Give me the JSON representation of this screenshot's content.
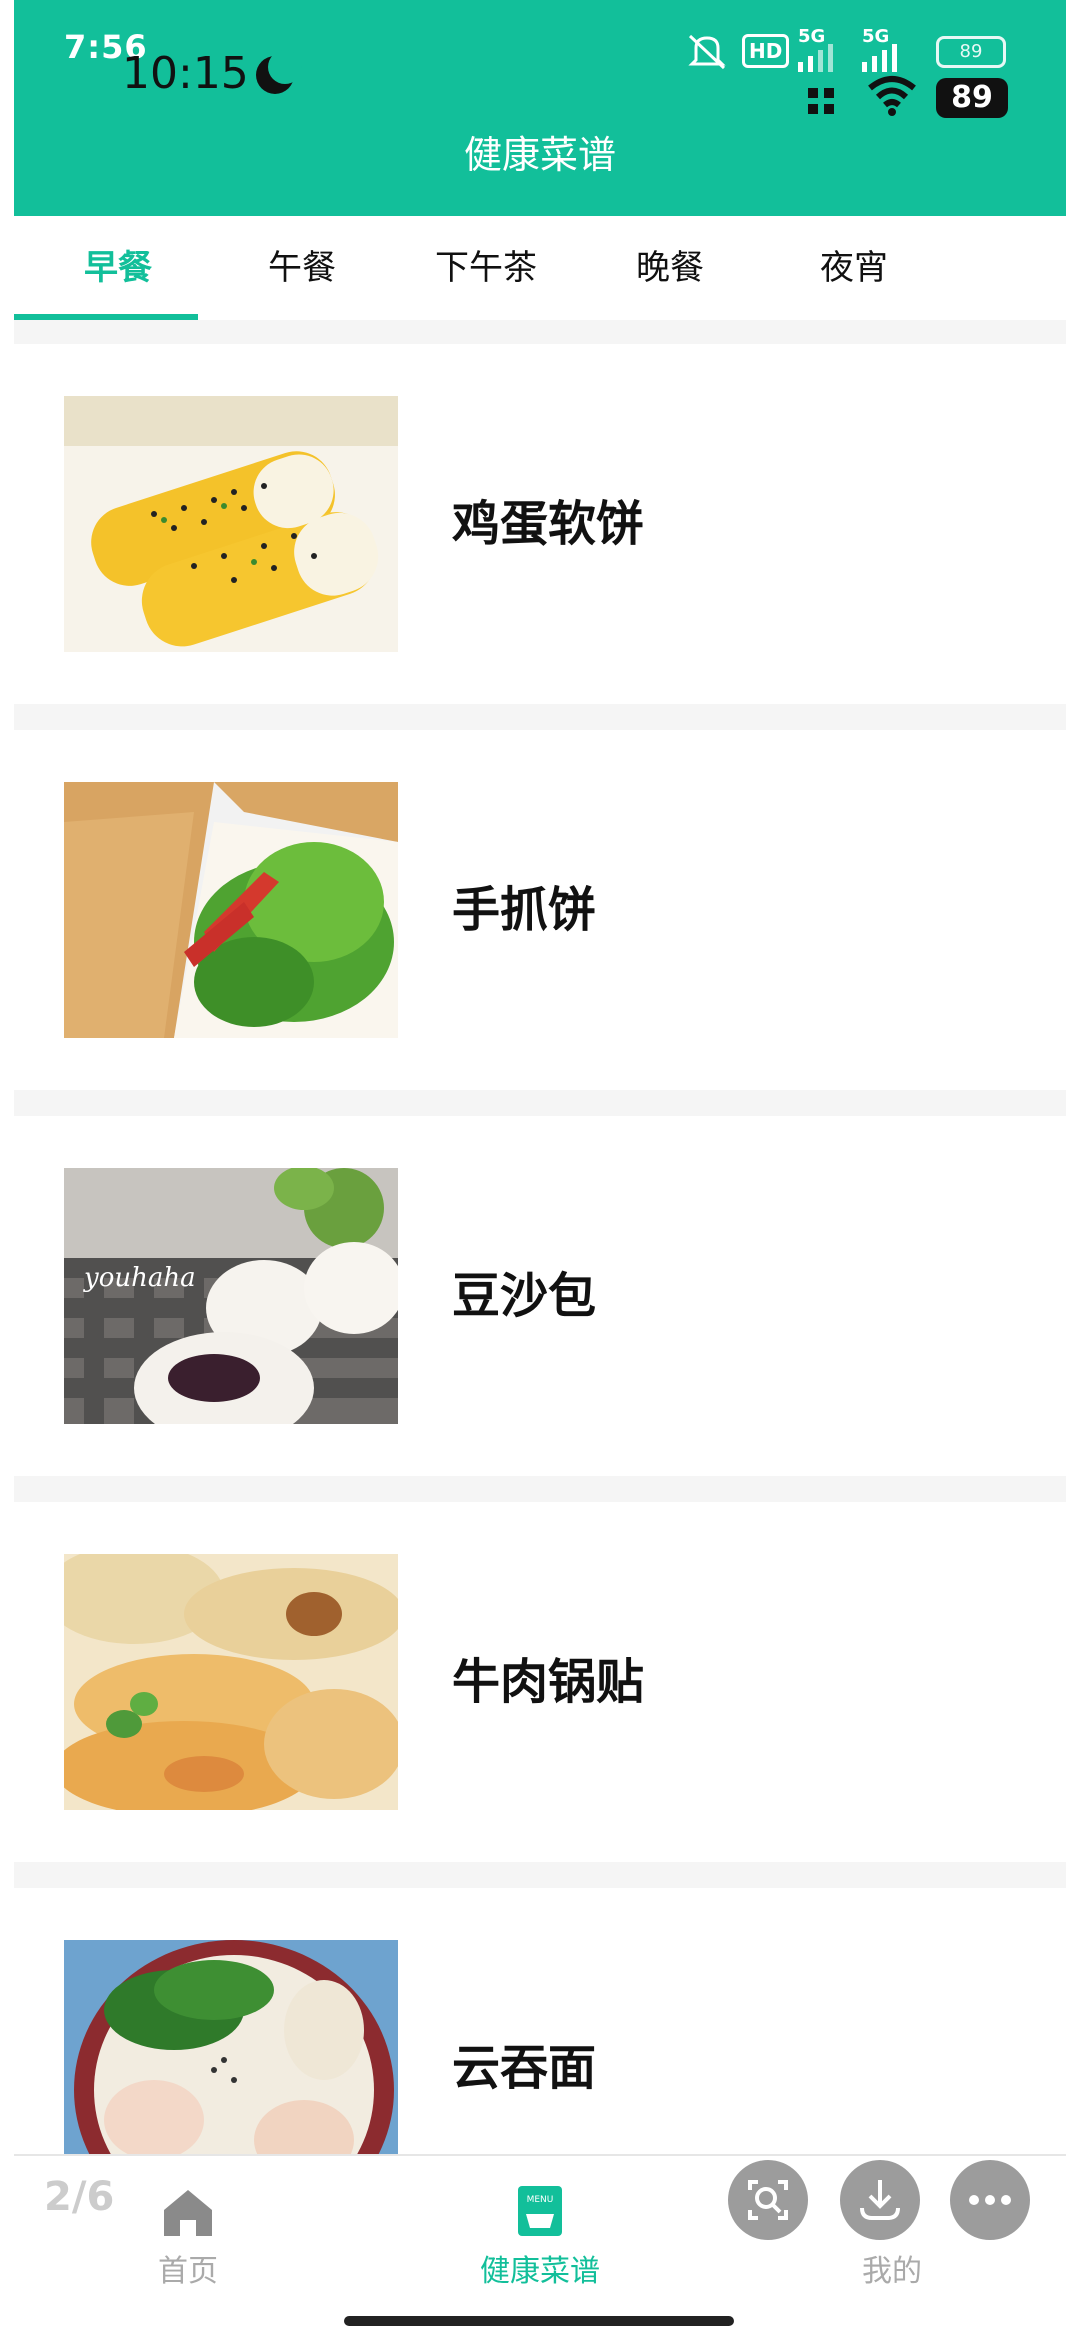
{
  "status_bar": {
    "time_overlay": "7:56",
    "time": "10:15",
    "hd_badge": "HD",
    "network_1": "5G",
    "network_2": "5G",
    "battery_outline": "89",
    "battery": "89"
  },
  "header": {
    "title": "健康菜谱"
  },
  "tabs": [
    {
      "label": "早餐",
      "active": true
    },
    {
      "label": "午餐",
      "active": false
    },
    {
      "label": "下午茶",
      "active": false
    },
    {
      "label": "晚餐",
      "active": false
    },
    {
      "label": "夜宵",
      "active": false
    }
  ],
  "recipes": [
    {
      "name": "鸡蛋软饼",
      "image_icon": "egg-pancake-roll-photo"
    },
    {
      "name": "手抓饼",
      "image_icon": "hand-grabbed-pancake-photo"
    },
    {
      "name": "豆沙包",
      "image_icon": "red-bean-bun-photo",
      "image_watermark": "youhaha"
    },
    {
      "name": "牛肉锅贴",
      "image_icon": "beef-potsticker-photo"
    },
    {
      "name": "云吞面",
      "image_icon": "wonton-noodle-photo"
    }
  ],
  "bottom_nav": {
    "page_indicator": "2/6",
    "items": [
      {
        "label": "首页",
        "icon": "home-icon",
        "active": false
      },
      {
        "label": "健康菜谱",
        "icon": "menu-book-icon",
        "icon_text": "MENU",
        "active": true
      },
      {
        "label": "我的",
        "icon": "profile-icon",
        "active": false
      }
    ]
  },
  "floating_buttons": [
    {
      "icon": "image-search-icon"
    },
    {
      "icon": "download-icon"
    },
    {
      "icon": "more-icon"
    }
  ],
  "colors": {
    "accent": "#12bf9a",
    "background": "#f5f5f5"
  }
}
